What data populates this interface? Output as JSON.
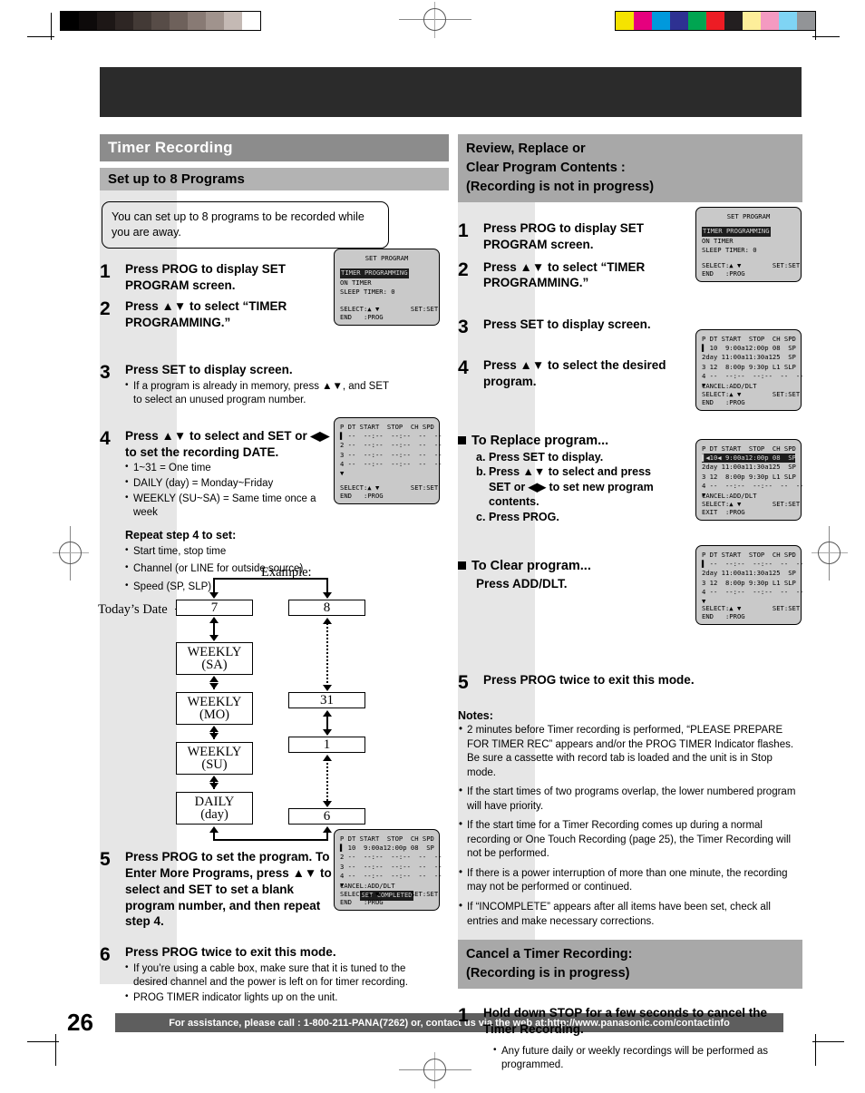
{
  "calibration": {
    "gray_swatches": [
      "#000000",
      "#0d0a0a",
      "#1d1716",
      "#2e2624",
      "#433a36",
      "#574c47",
      "#6e615b",
      "#887a74",
      "#a0938d",
      "#c4b9b4",
      "#ffffff"
    ],
    "color_swatches": [
      "#f5e300",
      "#e6007e",
      "#0099dc",
      "#2e3192",
      "#00a551",
      "#ed1c24",
      "#231f20",
      "#fdee9a",
      "#f49ac1",
      "#7fd4f4",
      "#929497"
    ]
  },
  "left": {
    "header": "Timer Recording",
    "subheader": "Set up to 8 Programs",
    "callout": "You can set up to 8 programs to be recorded while you are away.",
    "steps": [
      {
        "num": "1",
        "text": "Press PROG to display SET PROGRAM screen."
      },
      {
        "num": "2",
        "text": "Press ▲▼ to select “TIMER PROGRAMMING.”"
      },
      {
        "num": "3",
        "text": "Press SET to display screen.",
        "bullets": [
          "If a program is already in memory, press ▲▼, and SET to select an unused program number."
        ]
      },
      {
        "num": "4",
        "text": "Press ▲▼ to select and SET or ◀▶ to set the recording DATE.",
        "bullets": [
          "1~31 = One time",
          "DAILY (day) = Monday~Friday",
          "WEEKLY (SU~SA) = Same time once a week"
        ]
      },
      {
        "num": "5",
        "text": "Press PROG to set the program. To Enter More Programs, press ▲▼ to select and SET to set a blank program number, and then repeat step 4."
      },
      {
        "num": "6",
        "text": "Press PROG twice to exit this mode.",
        "bullets": [
          "If you’re using a cable box, make sure that it is tuned to the desired channel and the power is left on for timer recording.",
          "PROG TIMER indicator lights up on the unit."
        ]
      }
    ],
    "repeat_label": "Repeat step 4 to set:",
    "repeat_bullets": [
      "Start time, stop time",
      "Channel (or LINE for outside source)",
      "Speed (SP, SLP)"
    ]
  },
  "right": {
    "header_lines": [
      "Review, Replace or",
      "Clear Program Contents :",
      "(Recording is not in progress)"
    ],
    "steps": [
      {
        "num": "1",
        "text": "Press PROG to display SET PROGRAM screen."
      },
      {
        "num": "2",
        "text": "Press ▲▼ to select “TIMER PROGRAMMING.”"
      },
      {
        "num": "3",
        "text": "Press SET to display screen."
      },
      {
        "num": "4",
        "text": "Press ▲▼ to select the desired program."
      },
      {
        "num": "5",
        "text": "Press PROG twice to exit this mode."
      }
    ],
    "replace_title": "To Replace program...",
    "replace_items": [
      {
        "key": "a.",
        "text": "Press SET to display."
      },
      {
        "key": "b.",
        "text": "Press ▲▼ to select and press SET or ◀▶ to set new program contents."
      },
      {
        "key": "c.",
        "text": "Press PROG."
      }
    ],
    "clear_title": "To Clear program...",
    "clear_text": "Press ADD/DLT.",
    "notes_title": "Notes:",
    "notes": [
      "2 minutes before Timer recording is performed, “PLEASE PREPARE FOR TIMER REC” appears and/or the PROG TIMER Indicator flashes. Be sure a cassette with record tab is loaded and the unit is in Stop mode.",
      "If the start times of two programs overlap, the lower numbered program will have priority.",
      "If the start time for a Timer Recording comes up during a normal recording or One Touch Recording (page 25), the Timer Recording will not be performed.",
      "If there is a power interruption of more than one minute, the recording may not be performed or continued.",
      "If “INCOMPLETE” appears after all items have been set, check all entries and make necessary corrections."
    ],
    "cancel_header_lines": [
      "Cancel a Timer Recording:",
      "(Recording is in progress)"
    ],
    "cancel_step": {
      "num": "1",
      "text": "Hold down STOP for a few seconds to cancel the Timer Recording."
    },
    "cancel_bullets": [
      "Any future daily or weekly recordings will be performed as programmed."
    ]
  },
  "lcd": {
    "set_program": {
      "title": "SET PROGRAM",
      "line_hl": "TIMER PROGRAMMING",
      "line2": "ON TIMER",
      "line3": "SLEEP TIMER: 0",
      "foot1": "SELECT:▲ ▼        SET:SET",
      "foot2": "END   :PROG"
    },
    "blank_table": {
      "head": "P DT START  STOP  CH SPD",
      "rows": [
        "▌ --  --:--  --:--  --  --",
        "2 --  --:--  --:--  --  --",
        "3 --  --:--  --:--  --  --",
        "4 --  --:--  --:--  --  --",
        "▼"
      ],
      "foot1": "SELECT:▲ ▼        SET:SET",
      "foot2": "END   :PROG"
    },
    "set_completed": {
      "head": "P DT START  STOP  CH SPD",
      "rows": [
        "▌ 10  9:00a12:00p 08  SP",
        "2 --  --:--  --:--  --  --",
        "3 --  --:--  --:--  --  --",
        "4 --  --:--  --:--  --  --",
        "▼"
      ],
      "banner": "SET COMPLETED",
      "foot0": "CANCEL:ADD/DLT",
      "foot1": "SELECT:▲ ▼        SET:SET",
      "foot2": "END   :PROG"
    },
    "review": {
      "head": "P DT START  STOP  CH SPD",
      "rows": [
        "▌ 10  9:00a12:00p 08  SP",
        "2day 11:00a11:30a125  SP",
        "3 12  8:00p 9:30p L1 SLP",
        "4 --  --:--  --:--  --  --",
        "▼"
      ],
      "foot0": "CANCEL:ADD/DLT",
      "foot1": "SELECT:▲ ▼        SET:SET",
      "foot2": "END   :PROG"
    },
    "replace": {
      "head": "P DT START  STOP  CH SPD",
      "row_hl": "▌◀10◀ 9:00a12:00p 08  SP",
      "rows": [
        "2day 11:00a11:30a125  SP",
        "3 12  8:00p 9:30p L1 SLP",
        "4 --  --:--  --:--  --  --",
        "▼"
      ],
      "foot0": "CANCEL:ADD/DLT",
      "foot1": "SELECT:▲ ▼        SET:SET",
      "foot2": "EXIT  :PROG"
    },
    "cleared": {
      "head": "P DT START  STOP  CH SPD",
      "rows": [
        "▌ --  --:--  --:--  --  --",
        "2day 11:00a11:30a125  SP",
        "3 12  8:00p 9:30p L1 SLP",
        "4 --  --:--  --:--  --  --",
        "▼"
      ],
      "foot1": "SELECT:▲ ▼        SET:SET",
      "foot2": "END   :PROG"
    }
  },
  "diagram": {
    "example_label": "Example:",
    "todays_date_label": "Today’s Date",
    "left_boxes": [
      "7",
      "WEEKLY\n(SA)",
      "WEEKLY\n(MO)",
      "WEEKLY\n(SU)",
      "DAILY\n(day)"
    ],
    "left_box_1": "7",
    "left_box_2_a": "WEEKLY",
    "left_box_2_b": "(SA)",
    "left_box_3_a": "WEEKLY",
    "left_box_3_b": "(MO)",
    "left_box_4_a": "WEEKLY",
    "left_box_4_b": "(SU)",
    "left_box_5_a": "DAILY",
    "left_box_5_b": "(day)",
    "right_box_1": "8",
    "right_box_2": "31",
    "right_box_3": "1",
    "right_box_4": "6"
  },
  "footer": {
    "page_number": "26",
    "text": "For assistance, please call : 1-800-211-PANA(7262) or, contact us via the web at:http://www.panasonic.com/contactinfo"
  }
}
